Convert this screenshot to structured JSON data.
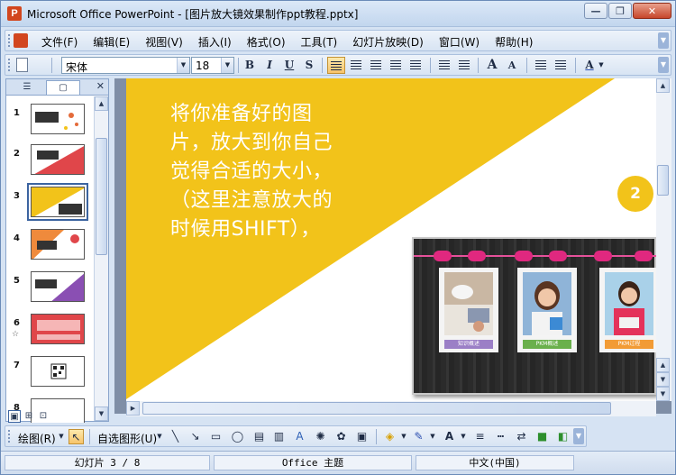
{
  "window": {
    "title": "Microsoft Office PowerPoint - [图片放大镜效果制作ppt教程.pptx]",
    "minimize_glyph": "—",
    "restore_glyph": "❐",
    "close_glyph": "✕"
  },
  "menu": {
    "items": [
      {
        "label": "文件(F)"
      },
      {
        "label": "编辑(E)"
      },
      {
        "label": "视图(V)"
      },
      {
        "label": "插入(I)"
      },
      {
        "label": "格式(O)"
      },
      {
        "label": "工具(T)"
      },
      {
        "label": "幻灯片放映(D)"
      },
      {
        "label": "窗口(W)"
      },
      {
        "label": "帮助(H)"
      }
    ]
  },
  "toolbar": {
    "font": "宋体",
    "size": "18",
    "bold": "B",
    "italic": "I",
    "underline": "U",
    "shadow": "S",
    "grow_font": "A",
    "shrink_font": "A",
    "font_color": "A"
  },
  "pane": {
    "thumbs": [
      {
        "num": "1"
      },
      {
        "num": "2"
      },
      {
        "num": "3"
      },
      {
        "num": "4"
      },
      {
        "num": "5"
      },
      {
        "num": "6",
        "star": "☆"
      },
      {
        "num": "7"
      },
      {
        "num": "8"
      }
    ],
    "selected_index": 3
  },
  "slide": {
    "body_text": "将你准备好的图片，放大到你自己觉得合适的大小，（这里注意放大的时候用SHIFT），",
    "number_badge": "2",
    "cards": [
      {
        "label": "知识概述"
      },
      {
        "label": "PKM概述"
      },
      {
        "label": "PKM过程"
      }
    ],
    "colors": {
      "triangle": "#f2c31a",
      "badge": "#f2c31a",
      "string": "#e5519a",
      "card_label_purple": "#9b7fc6",
      "card_label_green": "#6ab04c",
      "card_label_orange": "#f29b35"
    }
  },
  "drawbar": {
    "draw_label": "绘图(R)",
    "autoshape_label": "自选图形(U)"
  },
  "status": {
    "slide_pos": "幻灯片 3 / 8",
    "theme": "Office 主题",
    "language": "中文(中国)"
  }
}
